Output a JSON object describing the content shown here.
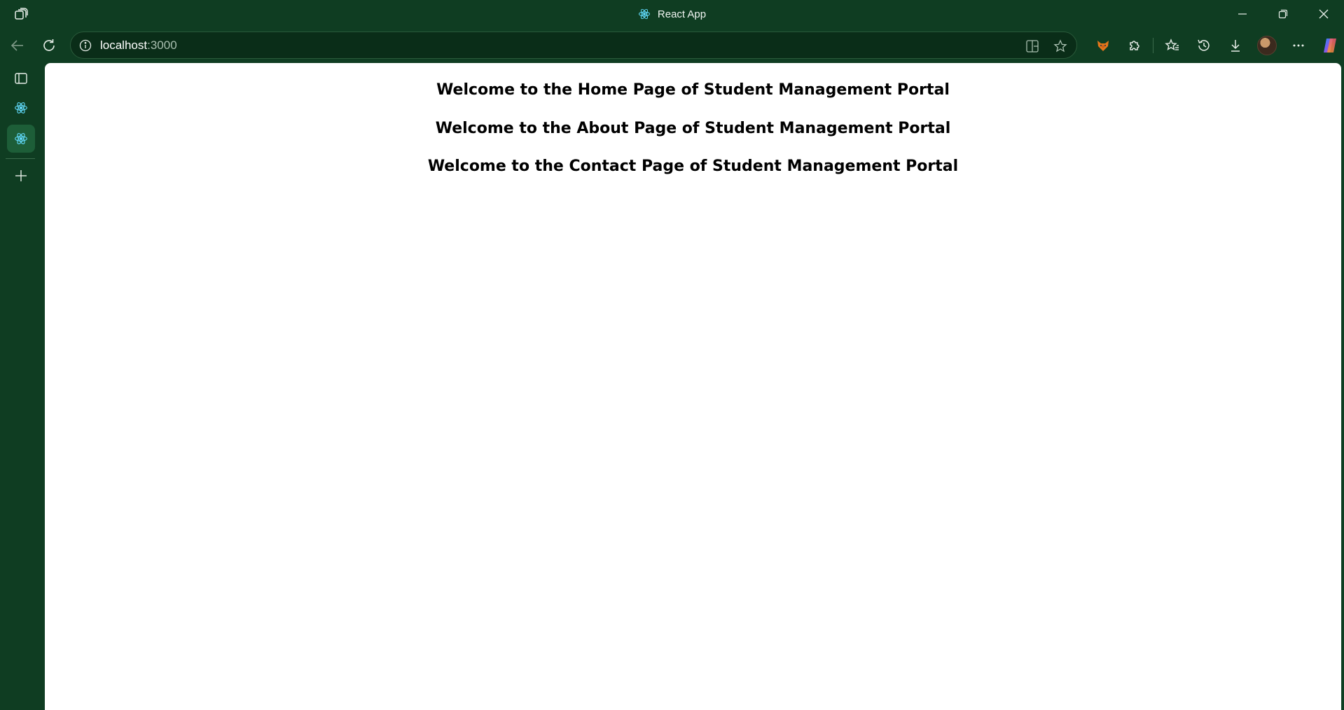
{
  "window": {
    "title": "React App"
  },
  "toolbar": {
    "url_host": "localhost",
    "url_port": ":3000"
  },
  "icons": {
    "workspaces": "workspaces-icon",
    "back": "back-arrow-icon",
    "reload": "reload-icon",
    "site_info": "info-icon",
    "split_screen": "split-screen-icon",
    "favorite": "star-icon",
    "extension_fox": "fox-extension-icon",
    "extensions": "puzzle-icon",
    "favorites": "favorites-icon",
    "history": "history-icon",
    "downloads": "download-icon",
    "profile": "avatar",
    "more": "more-icon",
    "copilot": "copilot-icon",
    "vertical_tabs": "vertical-tabs-icon",
    "react": "react-icon",
    "new_tab": "plus-icon"
  },
  "colors": {
    "frame": "#0f3d22",
    "address_bg": "#0a2d18",
    "active_tab": "#1d5e38",
    "react_blue": "#61dafb",
    "content_bg": "#ffffff"
  },
  "page": {
    "headings": [
      "Welcome to the Home Page of Student Management Portal",
      "Welcome to the About Page of Student Management Portal",
      "Welcome to the Contact Page of Student Management Portal"
    ]
  }
}
